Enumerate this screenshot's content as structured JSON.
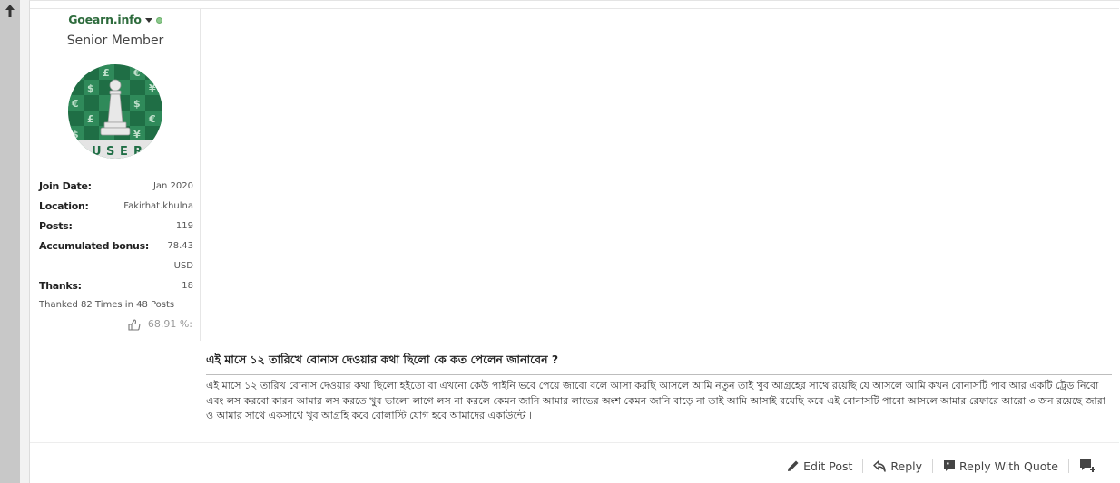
{
  "user": {
    "name": "Goearn.info",
    "title": "Senior Member",
    "avatar_text": "USER",
    "stats": [
      {
        "label": "Join Date:",
        "value": "Jan 2020"
      },
      {
        "label": "Location:",
        "value": "Fakirhat.khulna"
      },
      {
        "label": "Posts:",
        "value": "119"
      },
      {
        "label": "Accumulated bonus:",
        "value": "78.43"
      },
      {
        "label": "",
        "value": "USD"
      },
      {
        "label": "Thanks:",
        "value": "18"
      }
    ],
    "thanked": "Thanked 82 Times in 48 Posts",
    "percent": "68.91 %:"
  },
  "post": {
    "title": "এই মাসে ১২ তারিখে বোনাস দেওয়ার কথা ছিলো কে কত পেলেন জানাবেন ?",
    "body": "এই মাসে ১২ তারিখ বোনাস দেওয়ার কথা ছিলো হইতো বা এখনো কেউ পাইনি ভবে পেয়ে জাবো বলে আসা করছি আসলে আমি নতুন তাই খুব আগ্রহের সাথে রয়েছি যে আসলে আমি কখন বোনাসটি পাব আর একটি ট্রেড নিবো এবং লস করবো কারন আমার লস করতে খুব ভালো লাগে লস না করলে কেমন জানি আমার লাভের অংশ কেমন জানি বাড়ে না তাই আমি আসাই রয়েছি কবে এই বোনাসটি পাবো আসলে আমার রেফারে আরো ৩ জন রয়েছে জারা ও আমার সাথে একসাথে খুব আগ্রহি কবে বোলাস্টি যোগ হবে আমাদের একাউন্টে ।"
  },
  "actions": {
    "edit": "Edit Post",
    "reply": "Reply",
    "quote": "Reply With Quote"
  },
  "colors": {
    "username": "#2d6b3c",
    "online": "#8dc98d",
    "avatar_bg": "#1f6e45"
  },
  "icons": [
    "up-arrow-icon",
    "caret-down-icon",
    "online-status-icon",
    "thumbs-up-icon",
    "pencil-icon",
    "reply-icon",
    "quote-icon",
    "multiquote-icon"
  ]
}
